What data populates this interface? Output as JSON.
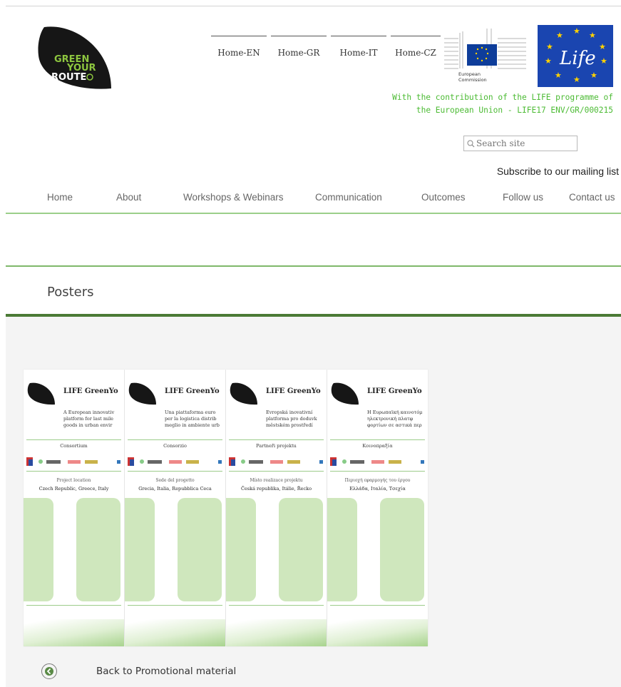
{
  "logo": {
    "line1": "GREEN",
    "line2": "YOUR",
    "line3": "ROUTE"
  },
  "lang_nav": [
    "Home-EN",
    "Home-GR",
    "Home-IT",
    "Home-CZ"
  ],
  "ec_logo": {
    "line1": "European",
    "line2": "Commission"
  },
  "life_logo": {
    "text": "Life"
  },
  "contribution": {
    "line1": "With the contribution of the LIFE programme of",
    "line2": "the European Union - LIFE17 ENV/GR/000215"
  },
  "search": {
    "placeholder": "Search site"
  },
  "subscribe": "Subscribe to our mailing list",
  "main_nav": [
    "Home",
    "About",
    "Workshops & Webinars",
    "Communication",
    "Outcomes",
    "Follow us",
    "Contact us"
  ],
  "page": {
    "title": "Posters"
  },
  "posters": [
    {
      "title": "LIFE GreenYo",
      "subtitle": "A European innovativ platform for last mile goods in urban envir",
      "section": "Consortium",
      "loc_label": "Project location",
      "loc_value": "Czech Republic, Greece, Italy"
    },
    {
      "title": "LIFE GreenYo",
      "subtitle": "Una piattaforma euro per la logistica distrib meglio in ambiente urb",
      "section": "Consorzio",
      "loc_label": "Sede del progetto",
      "loc_value": "Grecia, Italia, Repubblica Ceca"
    },
    {
      "title": "LIFE GreenYo",
      "subtitle": "Evropská inovativní platforma pro doduvk městském prostředí",
      "section": "Partneři projektu",
      "loc_label": "Místo realizace projektu",
      "loc_value": "Česká republika, Itálie, Řecko"
    },
    {
      "title": "LIFE GreenYo",
      "subtitle": "Η Ευρωπαϊκή καινοτόμ ηλεκτρονική πλατφ φορτίων σε αστικά περ",
      "section": "Κοινοπραξία",
      "loc_label": "Περιοχή εφαρμογής του έργου",
      "loc_value": "Ελλάδα, Ιταλία, Τσεχία"
    }
  ],
  "back_link": "Back to Promotional material",
  "colors": {
    "accent_green": "#4cbb34",
    "dark_green": "#4b7a36",
    "life_blue": "#1a45b0",
    "ec_blue": "#0e3d9a"
  }
}
